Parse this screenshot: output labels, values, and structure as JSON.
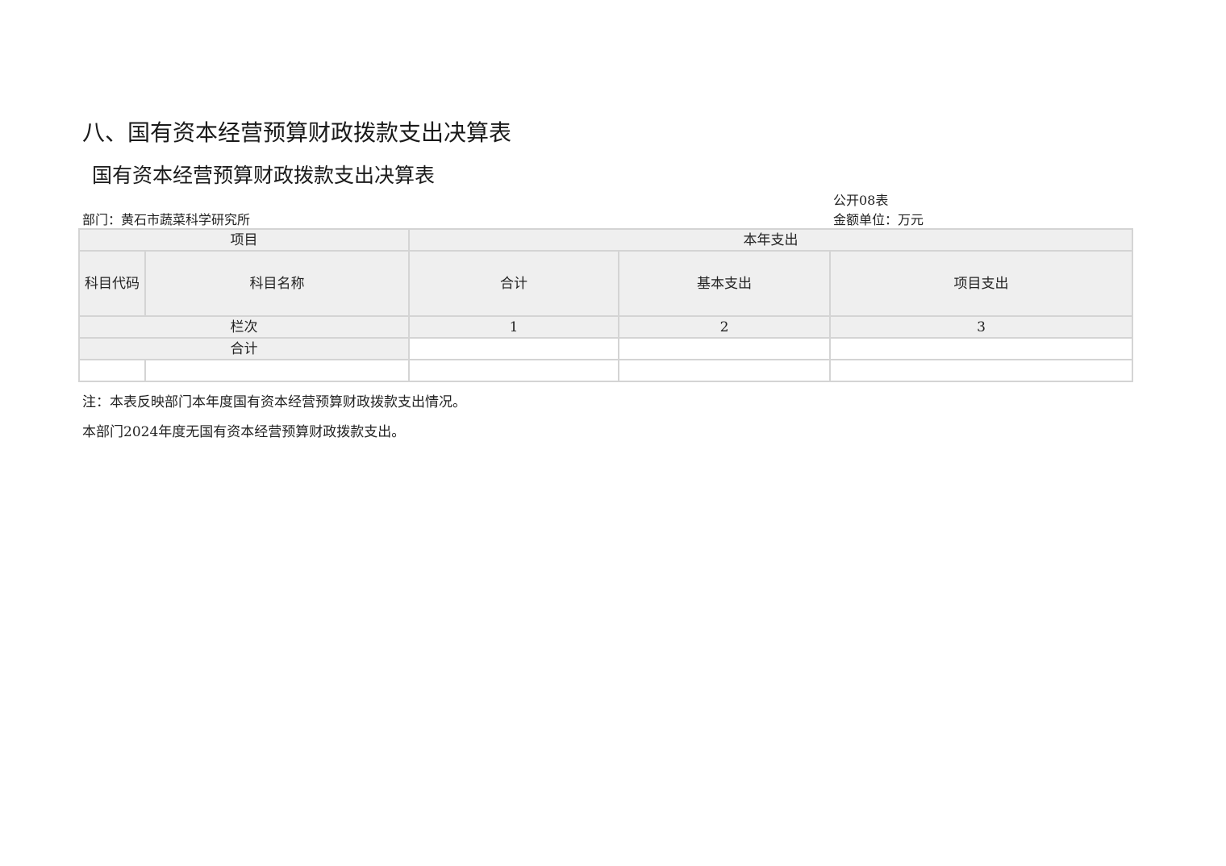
{
  "document": {
    "section_heading": "八、国有资本经营预算财政拨款支出决算表",
    "table_title": "国有资本经营预算财政拨款支出决算表",
    "form_no": "公开08表",
    "department": "部门：黄石市蔬菜科学研究所",
    "unit": "金额单位：万元"
  },
  "table": {
    "header": {
      "item": "项目",
      "current_year": "本年支出",
      "code": "科目代码",
      "name": "科目名称",
      "total": "合计",
      "basic": "基本支出",
      "project": "项目支出"
    },
    "column_index_row": {
      "label": "栏次",
      "c1": "1",
      "c2": "2",
      "c3": "3"
    },
    "total_row": {
      "label": "合计",
      "total": "",
      "basic": "",
      "project": ""
    },
    "data_rows": [
      {
        "code": "",
        "name": "",
        "total": "",
        "basic": "",
        "project": ""
      }
    ]
  },
  "notes": {
    "note1": "注：本表反映部门本年度国有资本经营预算财政拨款支出情况。",
    "note2": "本部门2024年度无国有资本经营预算财政拨款支出。"
  }
}
